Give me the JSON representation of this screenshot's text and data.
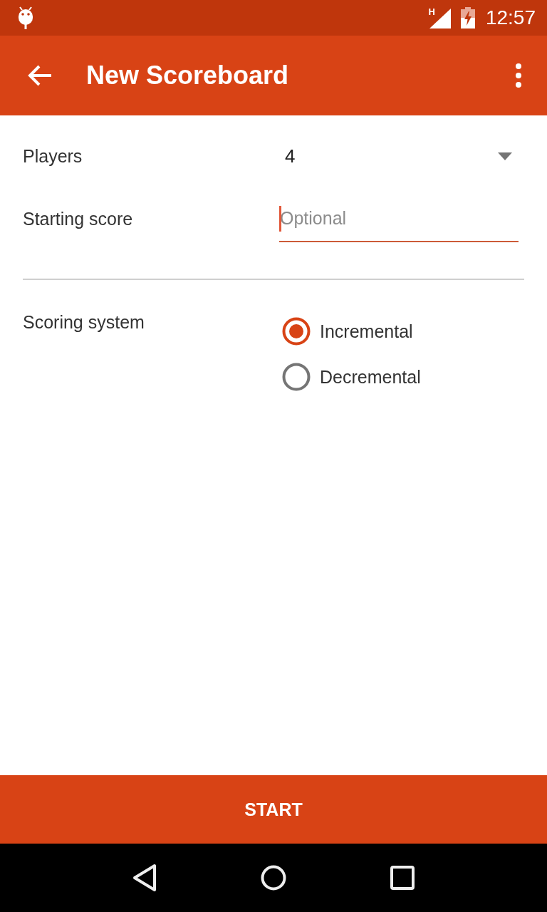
{
  "status_bar": {
    "network_type": "H",
    "time": "12:57"
  },
  "app_bar": {
    "title": "New Scoreboard"
  },
  "form": {
    "players": {
      "label": "Players",
      "value": "4"
    },
    "starting_score": {
      "label": "Starting score",
      "placeholder": "Optional",
      "focused": true
    },
    "scoring_system": {
      "label": "Scoring system",
      "options": [
        {
          "label": "Incremental",
          "selected": true
        },
        {
          "label": "Decremental",
          "selected": false
        }
      ]
    }
  },
  "start_button": {
    "label": "START"
  }
}
